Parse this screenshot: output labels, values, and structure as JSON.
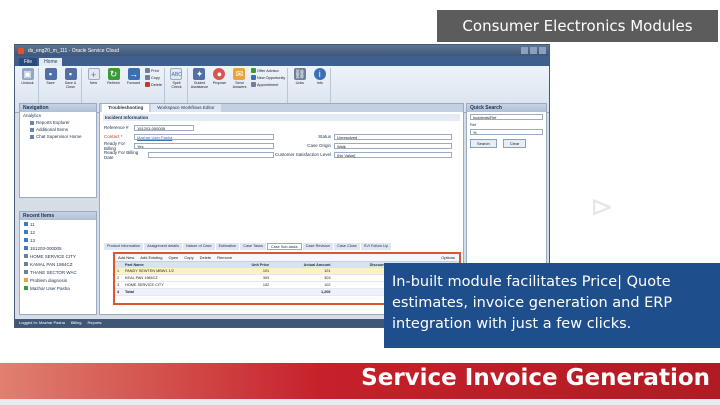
{
  "banner_title": "Consumer Electronics Modules",
  "caption_text": "In-built module facilitates Price| Quote estimates, invoice generation and ERP integration with just a few clicks.",
  "bottom_title": "Service Invoice Generation",
  "colors": {
    "caption_bg": "#1f4e8c",
    "bottom_bar": "#c6202a",
    "grid_highlight": "#e0542a",
    "banner_bg": "#5c5c5c"
  },
  "app": {
    "window_title": "ds_eng20_m_111 - Oracle Service Cloud",
    "menu_tabs": [
      "File",
      "Home"
    ],
    "ribbon_groups": [
      {
        "label": "Layout",
        "buttons": [
          {
            "label": "Undock",
            "icon": "undock-icon"
          }
        ]
      },
      {
        "label": "Edit",
        "buttons": [
          {
            "label": "Save",
            "icon": "save-icon"
          },
          {
            "label": "Save & Close",
            "icon": "save-close-icon"
          }
        ]
      },
      {
        "label": "Actions",
        "buttons": [
          {
            "label": "New",
            "icon": "new-icon"
          },
          {
            "label": "Refresh",
            "icon": "refresh-icon"
          },
          {
            "label": "Forward",
            "icon": "forward-icon"
          }
        ],
        "small": [
          "Print",
          "Copy",
          "Delete"
        ]
      },
      {
        "label": "Proofing",
        "buttons": [
          {
            "label": "Spell Check",
            "icon": "spell-check-icon"
          }
        ]
      },
      {
        "label": "Incident Actions",
        "buttons": [
          {
            "label": "Guided Assistance",
            "icon": "guided-assistance-icon"
          },
          {
            "label": "Propose",
            "icon": "propose-icon"
          },
          {
            "label": "Send Answers",
            "icon": "send-answers-icon"
          }
        ],
        "small": [
          "Offer Advisor",
          "New Opportunity",
          "Appointment"
        ]
      },
      {
        "label": "Links and Help",
        "buttons": [
          {
            "label": "Links",
            "icon": "links-icon"
          },
          {
            "label": "Info",
            "icon": "info-icon"
          }
        ]
      }
    ],
    "navigation": {
      "title": "Navigation",
      "section": "Analytics",
      "items": [
        "Reports Explorer",
        "Additional Items",
        "Chat Supervisor Home"
      ]
    },
    "recent_items": {
      "title": "Recent Items",
      "items": [
        "11",
        "12",
        "13",
        "151203-000005",
        "HOME SERVICE CITY",
        "KAMAL PAN 1984CZ",
        "THANE SECTOR WAC",
        "Problem diagnosis",
        "Mazhar User Pasha"
      ]
    },
    "doc_tabs": [
      "Troubleshooting",
      "Workspace Workflows Editor"
    ],
    "form": {
      "section": "Incident Information",
      "reference_label": "Reference #",
      "reference_value": "151203-000005",
      "contact_label": "Contact *",
      "contact_value": "Mazhar User Pasha",
      "status_label": "Status",
      "status_value": "Unresolved",
      "ready_billing_label": "Ready For Billing",
      "ready_billing_value": "Yes",
      "case_origin_label": "Case Origin",
      "case_origin_value": "Walk",
      "ready_billing_date_label": "Ready For Billing Date",
      "csat_label": "Customer Satisfaction Level",
      "csat_value": "[No Value]"
    },
    "sub_tabs": [
      "Product Information",
      "Assignment details",
      "Nature of Case",
      "Estimation",
      "Case Tasks",
      "Case Sub-tasks",
      "Case Revision",
      "Case Close",
      "SVI Follow Up"
    ],
    "grid": {
      "toolbar": [
        "Add New",
        "Add Existing",
        "Open",
        "Copy",
        "Delete",
        "Remove"
      ],
      "options_label": "Options",
      "columns": [
        "",
        "Part Name",
        "Unit Price",
        "Actual Amount",
        "Discount Amount",
        "Final Amount"
      ],
      "rows": [
        [
          "1",
          "PANDY SEWTEN MBW1 1/2",
          "101",
          "101",
          "0",
          "101"
        ],
        [
          "2",
          "KEAL PAN 1984CZ",
          "303",
          "303",
          "100",
          "200"
        ],
        [
          "3",
          "HOME SERVICE CITY",
          "102",
          "102",
          "0",
          "102"
        ]
      ],
      "total_row": [
        "4",
        "Total",
        "",
        "1,206",
        "100",
        "1,103"
      ]
    },
    "quick_search": {
      "title": "Quick Search",
      "type_value": "Incidents/Ref",
      "field_label": "Ref",
      "field_value": "%",
      "search_button": "Search",
      "clear_button": "Clear"
    },
    "status_bar": [
      "Logged In: Mazhar Pasha",
      "Billing",
      "Reports"
    ]
  }
}
